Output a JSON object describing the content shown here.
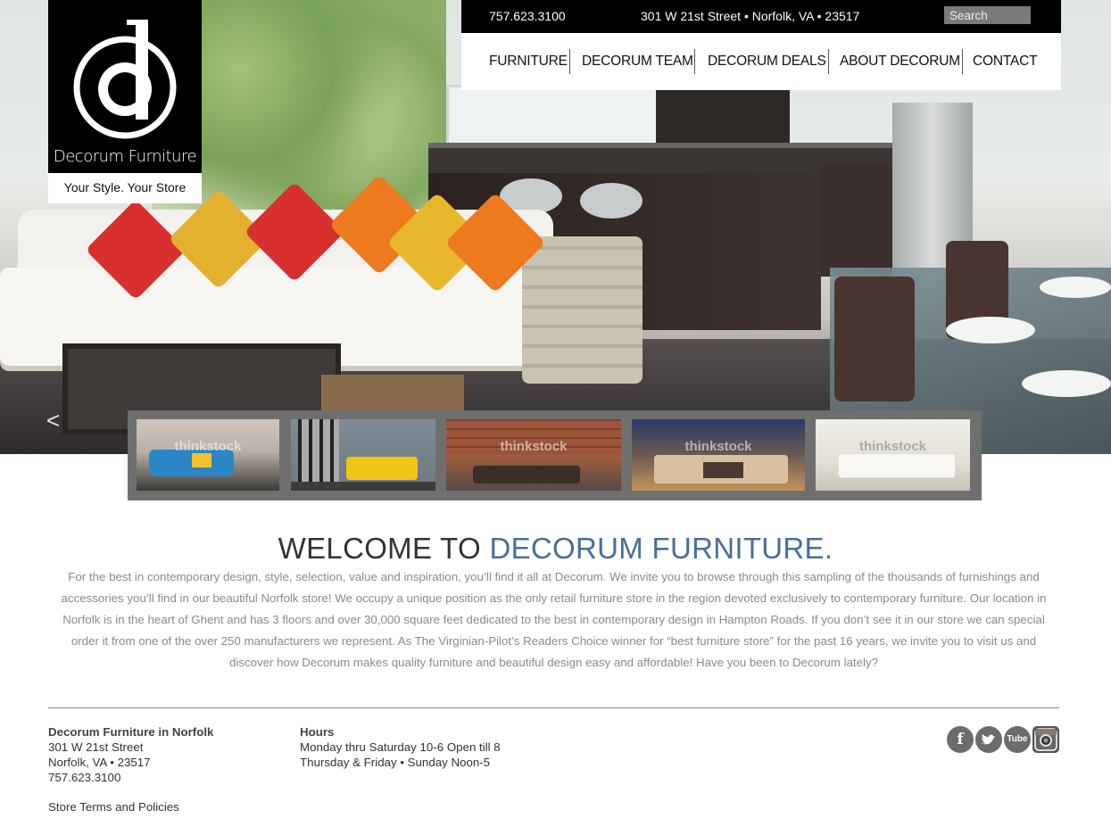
{
  "brand": {
    "name": "Decorum Furniture",
    "tagline": "Your Style. Your Store"
  },
  "topbar": {
    "phone": "757.623.3100",
    "address": "301 W 21st Street • Norfolk, VA • 23517",
    "search_placeholder": "Search"
  },
  "nav": {
    "items": [
      {
        "label": "FURNITURE"
      },
      {
        "label": "DECORUM TEAM"
      },
      {
        "label": "DECORUM DEALS"
      },
      {
        "label": "ABOUT DECORUM"
      },
      {
        "label": "CONTACT"
      }
    ]
  },
  "slider": {
    "prev_arrow": "<",
    "thumb_watermark": "thinkstock"
  },
  "welcome": {
    "title_prefix": "WELCOME TO ",
    "title_accent": "DECORUM FURNITURE.",
    "body": "For the best in contemporary design, style, selection, value and inspiration, you’ll find it all at Decorum.  We invite you to browse through this sampling of the thousands of furnishings and accessories you’ll find in our beautiful Norfolk store! We occupy a unique position as the only retail furniture store in the region devoted exclusively to contemporary furniture. Our location in Norfolk is in the heart of Ghent and has 3 floors and over 30,000 square feet dedicated to the best in contemporary design in Hampton Roads. If you don’t see it in our store we can special order it from one of the over 250 manufacturers we represent. As The Virginian-Pilot’s Readers Choice winner for “best furniture store” for the past 16 years, we invite you to visit us and discover how Decorum makes quality furniture and beautiful design easy and affordable! Have you been to Decorum lately?"
  },
  "footer": {
    "store_heading": "Decorum Furniture in Norfolk",
    "street": "301 W 21st Street",
    "city": "Norfolk, VA  •  23517",
    "phone": "757.623.3100",
    "hours_heading": "Hours",
    "hours_line1": "Monday thru Saturday 10-6 Open till 8",
    "hours_line2": "Thursday & Friday • Sunday Noon-5",
    "policies_link": "Store Terms and Policies",
    "social": {
      "facebook": "f",
      "youtube": "Tube"
    }
  }
}
